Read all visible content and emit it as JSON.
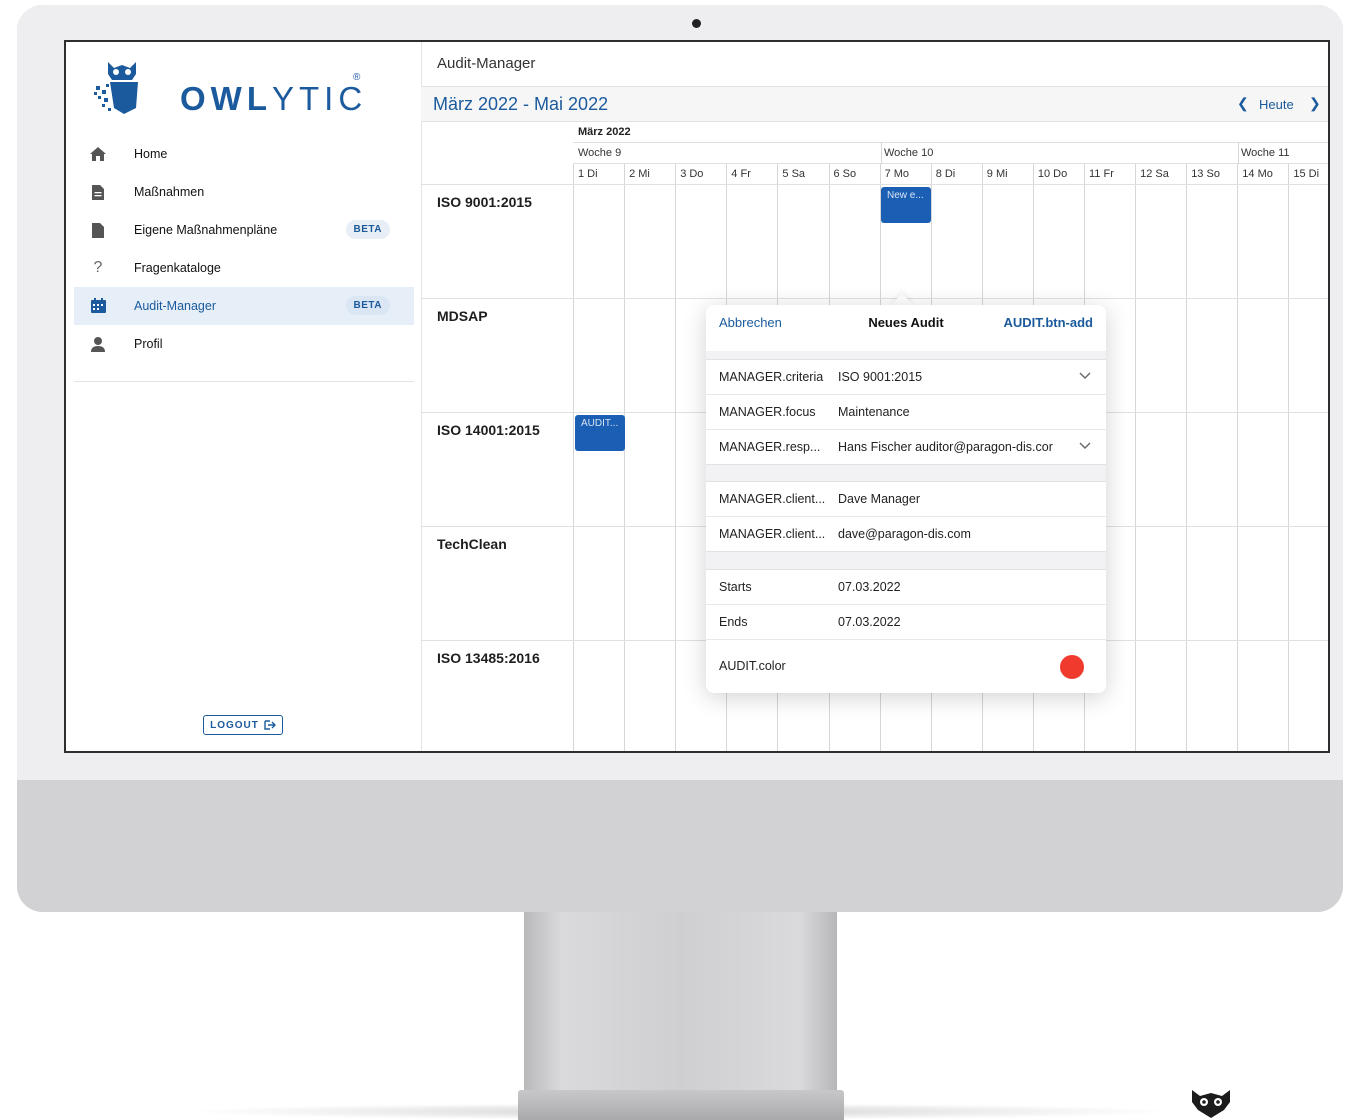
{
  "brand": {
    "logo_bold": "OWL",
    "logo_thin": "YTIC",
    "logo_reg": "®",
    "accent_color": "#1b5a9c",
    "event_color": "#1b5fb4",
    "audit_color": "#f03a2e"
  },
  "sidebar": {
    "items": [
      {
        "label": "Home",
        "icon": "home-icon",
        "badge": ""
      },
      {
        "label": "Maßnahmen",
        "icon": "document-icon",
        "badge": ""
      },
      {
        "label": "Eigene Maßnahmenpläne",
        "icon": "document-icon",
        "badge": "BETA"
      },
      {
        "label": "Fragenkataloge",
        "icon": "question-icon",
        "badge": ""
      },
      {
        "label": "Audit-Manager",
        "icon": "calendar-icon",
        "badge": "BETA",
        "active": true
      },
      {
        "label": "Profil",
        "icon": "user-icon",
        "badge": ""
      }
    ],
    "logout_label": "LOGOUT"
  },
  "header": {
    "app_title": "Audit-Manager",
    "range_title": "März 2022 - Mai 2022",
    "today_label": "Heute"
  },
  "calendar": {
    "month": "März 2022",
    "weeks": [
      "Woche 9",
      "Woche 10",
      "Woche 11"
    ],
    "days": [
      "1 Di",
      "2 Mi",
      "3 Do",
      "4 Fr",
      "5 Sa",
      "6 So",
      "7 Mo",
      "8 Di",
      "9 Mi",
      "10 Do",
      "11 Fr",
      "12 Sa",
      "13 So",
      "14 Mo",
      "15 Di"
    ],
    "rows": [
      "ISO 9001:2015",
      "MDSAP",
      "ISO 14001:2015",
      "TechClean",
      "ISO 13485:2016"
    ],
    "events": [
      {
        "label": "New e...",
        "row": "ISO 9001:2015",
        "day": "7 Mo"
      },
      {
        "label": "AUDIT...",
        "row": "ISO 14001:2015",
        "day": "1 Di"
      }
    ]
  },
  "popover": {
    "cancel_label": "Abbrechen",
    "title": "Neues Audit",
    "add_label": "AUDIT.btn-add",
    "fields": {
      "criteria_label": "MANAGER.criteria",
      "criteria_value": "ISO 9001:2015",
      "focus_label": "MANAGER.focus",
      "focus_value": "Maintenance",
      "resp_label": "MANAGER.resp...",
      "resp_value": "Hans Fischer auditor@paragon-dis.cor",
      "client_name_label": "MANAGER.client...",
      "client_name_value": "Dave Manager",
      "client_email_label": "MANAGER.client...",
      "client_email_value": "dave@paragon-dis.com",
      "starts_label": "Starts",
      "starts_value": "07.03.2022",
      "ends_label": "Ends",
      "ends_value": "07.03.2022",
      "color_label": "AUDIT.color"
    }
  }
}
